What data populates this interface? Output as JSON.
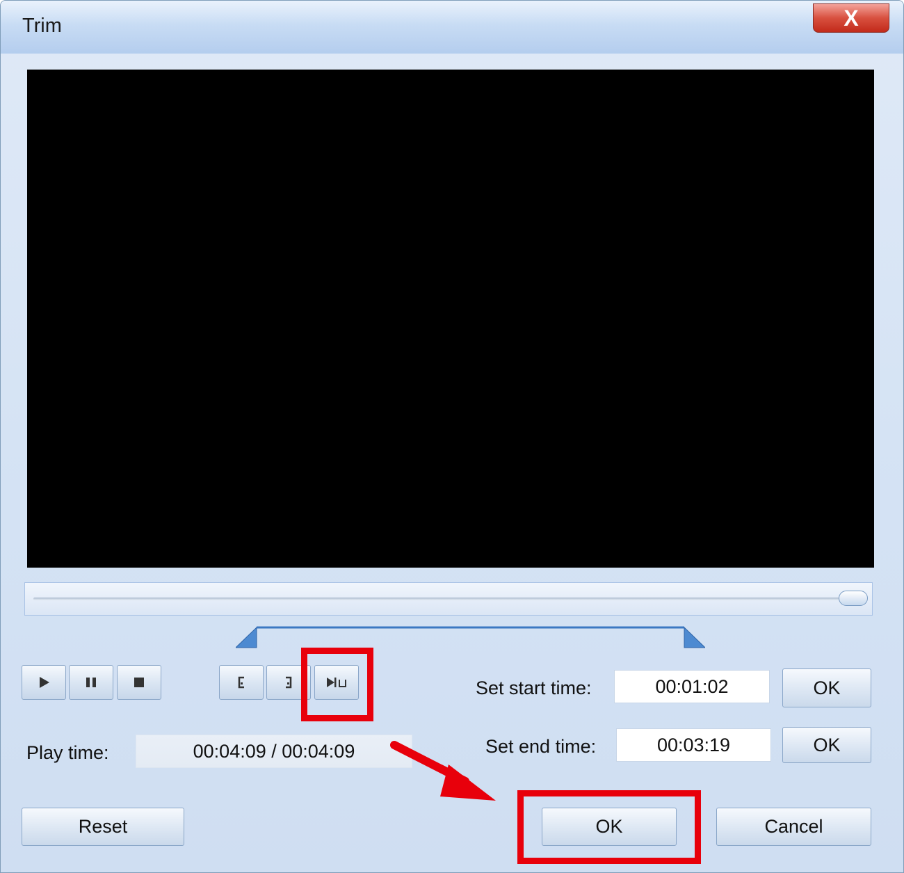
{
  "window": {
    "title": "Trim",
    "close_glyph": "X"
  },
  "player": {
    "video_area": "black preview",
    "seek_progress": 1.0
  },
  "transport": {
    "play_icon": "play-icon",
    "pause_icon": "pause-icon",
    "stop_icon": "stop-icon",
    "mark_start_icon": "mark-start-icon",
    "mark_end_icon": "mark-end-icon",
    "play_selection_icon": "play-selection-icon"
  },
  "playtime": {
    "label": "Play time:",
    "value": "00:04:09 / 00:04:09"
  },
  "start": {
    "label": "Set start time:",
    "value": "00:01:02",
    "ok_label": "OK"
  },
  "end": {
    "label": "Set end time:",
    "value": "00:03:19",
    "ok_label": "OK"
  },
  "footer": {
    "reset_label": "Reset",
    "ok_label": "OK",
    "cancel_label": "Cancel"
  },
  "annotation_color": "#e8000b"
}
